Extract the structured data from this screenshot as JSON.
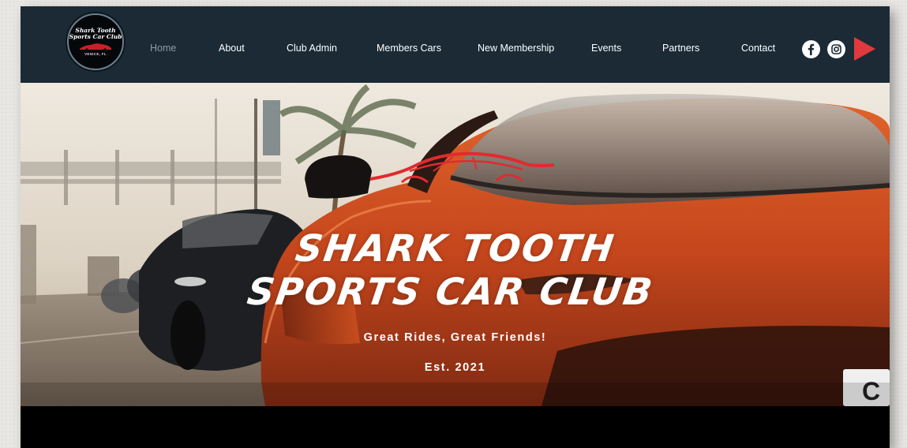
{
  "logo": {
    "line1": "Shark Tooth",
    "line2": "Sports Car Club",
    "location": "VENICE, FL"
  },
  "nav": {
    "items": [
      {
        "label": "Home",
        "active": true
      },
      {
        "label": "About"
      },
      {
        "label": "Club Admin"
      },
      {
        "label": "Members Cars"
      },
      {
        "label": "New Membership"
      },
      {
        "label": "Events"
      },
      {
        "label": "Partners"
      },
      {
        "label": "Contact"
      }
    ]
  },
  "social": {
    "icons": [
      "facebook-icon",
      "instagram-icon",
      "play-icon"
    ]
  },
  "hero": {
    "title_line1": "SHARK TOOTH",
    "title_line2": "SPORTS CAR CLUB",
    "tagline": "Great Rides, Great Friends!",
    "established": "Est. 2021"
  },
  "colors": {
    "header_bg": "#1b2a35",
    "accent_red": "#e0393e",
    "car_orange": "#c8461d",
    "nav_active": "#8f9ca6"
  }
}
